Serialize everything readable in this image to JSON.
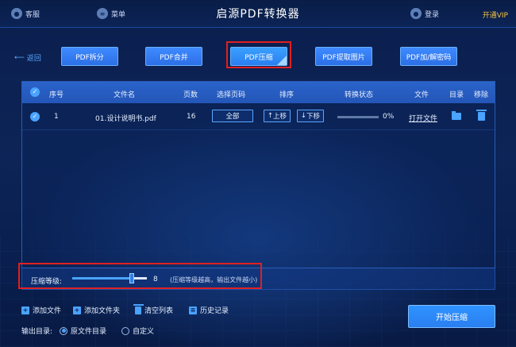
{
  "titlebar": {
    "title": "启源PDF转换器",
    "left_items": [
      {
        "label": "客服",
        "icon": "headset-icon"
      },
      {
        "label": "菜单",
        "icon": "menu-icon"
      }
    ],
    "login_label": "登录",
    "vip_label": "开通VIP",
    "vip_color": "#f5c542"
  },
  "toolbar": {
    "back_label": "返回",
    "buttons": [
      {
        "label": "PDF拆分",
        "active": false
      },
      {
        "label": "PDF合并",
        "active": false
      },
      {
        "label": "PDF压缩",
        "active": true
      },
      {
        "label": "PDF提取图片",
        "active": false
      },
      {
        "label": "PDF加/解密码",
        "active": false
      }
    ]
  },
  "table": {
    "headers": [
      "序号",
      "文件名",
      "页数",
      "选择页码",
      "排序",
      "转换状态",
      "文件",
      "目录",
      "移除"
    ],
    "rows": [
      {
        "index": "1",
        "filename": "01.设计说明书.pdf",
        "pages": "16",
        "page_select": "全部",
        "sort_up": "上移",
        "sort_down": "下移",
        "progress": 0,
        "progress_text": "0%",
        "open_file": "打开文件"
      }
    ]
  },
  "compress": {
    "label": "压缩等级:",
    "value": "8",
    "level_fraction": 0.8,
    "hint": "(压缩等级越高，输出文件越小)"
  },
  "actions": {
    "add_file": "添加文件",
    "add_folder": "添加文件夹",
    "clear_list": "清空列表",
    "history": "历史记录"
  },
  "output": {
    "label": "输出目录:",
    "option_source": "原文件目录",
    "option_custom": "自定义",
    "selected": "source"
  },
  "start_button": "开始压缩",
  "colors": {
    "accent": "#2f7fe8",
    "highlight_box": "#e02020",
    "background": "#0b1f4d"
  }
}
